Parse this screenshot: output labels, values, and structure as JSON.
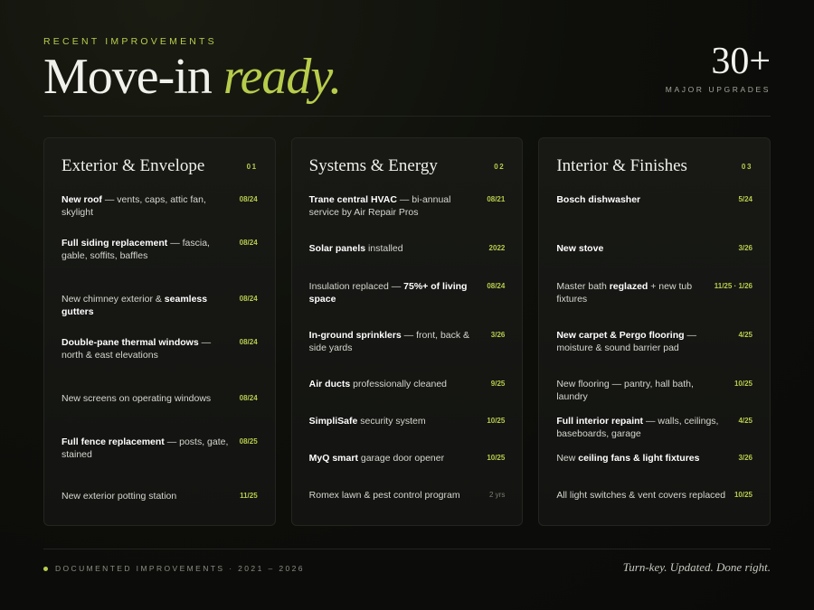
{
  "header": {
    "eyebrow": "RECENT IMPROVEMENTS",
    "title_main": "Move-in ",
    "title_accent": "ready.",
    "stat_value": "30+",
    "stat_label": "MAJOR UPGRADES"
  },
  "columns": [
    {
      "title": "Exterior & Envelope",
      "num": "01",
      "items": [
        {
          "parts": [
            {
              "t": "New roof",
              "b": true
            },
            {
              "t": " — vents, caps, attic fan, skylight"
            }
          ],
          "date": "08/24"
        },
        {
          "parts": [
            {
              "t": "Full siding replacement",
              "b": true
            },
            {
              "t": " — fascia, gable, soffits, baffles"
            }
          ],
          "date": "08/24"
        },
        {
          "parts": [
            {
              "t": "New chimney exterior & "
            },
            {
              "t": "seamless gutters",
              "b": true
            }
          ],
          "date": "08/24"
        },
        {
          "parts": [
            {
              "t": "Double-pane thermal windows",
              "b": true
            },
            {
              "t": " — north & east elevations"
            }
          ],
          "date": "08/24"
        },
        {
          "parts": [
            {
              "t": "New screens on operating windows"
            }
          ],
          "date": "08/24"
        },
        {
          "parts": [
            {
              "t": "Full fence replacement",
              "b": true
            },
            {
              "t": " — posts, gate, stained"
            }
          ],
          "date": "08/25"
        },
        {
          "parts": [
            {
              "t": "New exterior potting station"
            }
          ],
          "date": "11/25"
        }
      ]
    },
    {
      "title": "Systems & Energy",
      "num": "02",
      "items": [
        {
          "parts": [
            {
              "t": "Trane central HVAC",
              "b": true
            },
            {
              "t": " — bi-annual service by Air Repair Pros"
            }
          ],
          "date": "08/21"
        },
        {
          "parts": [
            {
              "t": "Solar panels",
              "b": true
            },
            {
              "t": " installed"
            }
          ],
          "date": "2022"
        },
        {
          "parts": [
            {
              "t": "Insulation replaced — "
            },
            {
              "t": "75%+ of living space",
              "b": true
            }
          ],
          "date": "08/24"
        },
        {
          "parts": [
            {
              "t": "In-ground sprinklers",
              "b": true
            },
            {
              "t": " — front, back & side yards"
            }
          ],
          "date": "3/26"
        },
        {
          "parts": [
            {
              "t": "Air ducts",
              "b": true
            },
            {
              "t": " professionally cleaned"
            }
          ],
          "date": "9/25"
        },
        {
          "parts": [
            {
              "t": "SimpliSafe",
              "b": true
            },
            {
              "t": " security system"
            }
          ],
          "date": "10/25"
        },
        {
          "parts": [
            {
              "t": "MyQ smart",
              "b": true
            },
            {
              "t": " garage door opener"
            }
          ],
          "date": "10/25"
        },
        {
          "parts": [
            {
              "t": "Romex lawn & pest control program"
            }
          ],
          "date": "2 yrs",
          "muted": true
        }
      ]
    },
    {
      "title": "Interior & Finishes",
      "num": "03",
      "items": [
        {
          "parts": [
            {
              "t": "Bosch dishwasher",
              "b": true
            }
          ],
          "date": "5/24"
        },
        {
          "parts": [
            {
              "t": "New stove",
              "b": true
            }
          ],
          "date": "3/26"
        },
        {
          "parts": [
            {
              "t": "Master bath "
            },
            {
              "t": "reglazed",
              "b": true
            },
            {
              "t": " + new tub fixtures"
            }
          ],
          "date": "11/25 · 1/26"
        },
        {
          "parts": [
            {
              "t": "New carpet & Pergo flooring",
              "b": true
            },
            {
              "t": " — moisture & sound barrier pad"
            }
          ],
          "date": "4/25"
        },
        {
          "parts": [
            {
              "t": "New flooring — pantry, hall bath, laundry"
            }
          ],
          "date": "10/25"
        },
        {
          "parts": [
            {
              "t": "Full interior repaint",
              "b": true
            },
            {
              "t": " — walls, ceilings, baseboards, garage"
            }
          ],
          "date": "4/25"
        },
        {
          "parts": [
            {
              "t": "New "
            },
            {
              "t": "ceiling fans & light fixtures",
              "b": true
            }
          ],
          "date": "3/26"
        },
        {
          "parts": [
            {
              "t": "All light switches & vent covers replaced"
            }
          ],
          "date": "10/25"
        }
      ]
    }
  ],
  "footer": {
    "left": "DOCUMENTED IMPROVEMENTS · 2021 – 2026",
    "right": "Turn-key. Updated. Done right."
  },
  "colors": {
    "accent": "#b8cc4c",
    "background": "#0e0f0b"
  }
}
